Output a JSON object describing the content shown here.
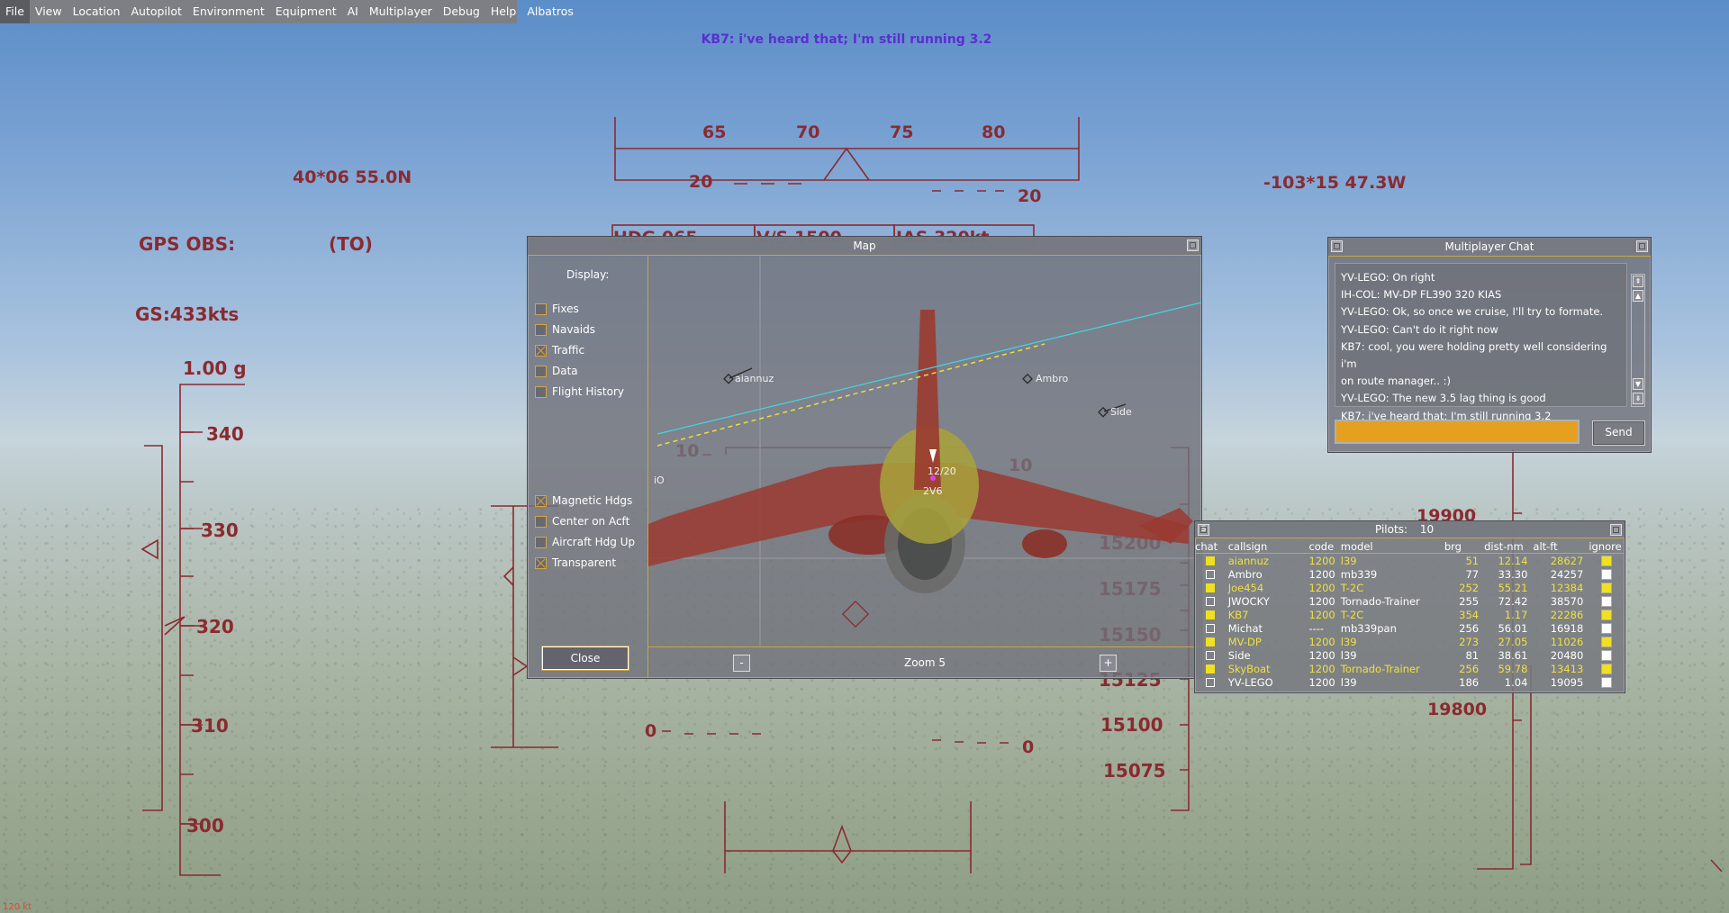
{
  "menu": [
    "File",
    "View",
    "Location",
    "Autopilot",
    "Environment",
    "Equipment",
    "AI",
    "Multiplayer",
    "Debug",
    "Help",
    "Albatros"
  ],
  "broadcast": "KB7: i've heard that; I'm still running 3.2",
  "hud": {
    "lat": "40*06 55.0N",
    "lon": "-103*15 47.3W",
    "gps_obs": "GPS OBS:",
    "to_from": "(TO)",
    "gs": "GS:433kts",
    "g_load": "1.00 g",
    "heading_ticks": [
      "65",
      "70",
      "75",
      "80"
    ],
    "pitch_top_left": "20",
    "pitch_top_right": "20",
    "pitch_mid_left": "10",
    "pitch_mid_right": "10",
    "pitch_zero_left": "0",
    "pitch_zero_right": "0",
    "hdg_box": "HDG 065",
    "vs_box": "V/S 1500",
    "ias_box": "IAS 320kt",
    "speed_ticks": [
      "340",
      "330",
      "320",
      "310",
      "300"
    ],
    "alt_ticks": [
      "15200",
      "15175",
      "15150",
      "15125",
      "15100",
      "15075"
    ],
    "alt_right_ticks": [
      "19900",
      "19800"
    ],
    "corner_text": "120 kt"
  },
  "map": {
    "title": "Map",
    "display_label": "Display:",
    "options": [
      {
        "label": "Fixes",
        "checked": false
      },
      {
        "label": "Navaids",
        "checked": false
      },
      {
        "label": "Traffic",
        "checked": true
      },
      {
        "label": "Data",
        "checked": false
      },
      {
        "label": "Flight History",
        "checked": false
      }
    ],
    "options2": [
      {
        "label": "Magnetic Hdgs",
        "checked": true
      },
      {
        "label": "Center on Acft",
        "checked": false
      },
      {
        "label": "Aircraft Hdg Up",
        "checked": false
      },
      {
        "label": "Transparent",
        "checked": true
      }
    ],
    "close_label": "Close",
    "zoom_label": "Zoom 5",
    "zoom_minus": "-",
    "zoom_plus": "+",
    "traffic": [
      "aiannuz",
      "Ambro",
      "Side"
    ],
    "own_label_top": "12/20",
    "own_label_bottom": "2V6",
    "edge_label": "iO"
  },
  "chat": {
    "title": "Multiplayer Chat",
    "messages": [
      "YV-LEGO: On right",
      "IH-COL: MV-DP FL390 320 KIAS",
      "YV-LEGO: Ok, so once we cruise, I'll try to formate.",
      "YV-LEGO: Can't do it right now",
      "KB7: cool, you were holding pretty well considering i'm",
      "on route manager.. :)",
      "YV-LEGO: The new 3.5 lag thing is good",
      "KB7: i've heard that; I'm still running 3.2"
    ],
    "input_value": "",
    "send_label": "Send"
  },
  "pilots": {
    "title": "Pilots:",
    "count": "10",
    "corner_btn": "S",
    "columns": [
      "chat",
      "callsign",
      "code",
      "model",
      "brg",
      "dist-nm",
      "alt-ft",
      "ignore"
    ],
    "rows": [
      {
        "callsign": "aiannuz",
        "code": "1200",
        "model": "l39",
        "brg": "51",
        "dist": "12.14",
        "alt": "28627",
        "sel": true,
        "ignore": true
      },
      {
        "callsign": "Ambro",
        "code": "1200",
        "model": "mb339",
        "brg": "77",
        "dist": "33.30",
        "alt": "24257",
        "sel": false,
        "ignore": false
      },
      {
        "callsign": "Joe454",
        "code": "1200",
        "model": "T-2C",
        "brg": "252",
        "dist": "55.21",
        "alt": "12384",
        "sel": true,
        "ignore": true
      },
      {
        "callsign": "JWOCKY",
        "code": "1200",
        "model": "Tornado-Trainer",
        "brg": "255",
        "dist": "72.42",
        "alt": "38570",
        "sel": false,
        "ignore": false
      },
      {
        "callsign": "KB7",
        "code": "1200",
        "model": "T-2C",
        "brg": "354",
        "dist": "1.17",
        "alt": "22286",
        "sel": true,
        "ignore": true
      },
      {
        "callsign": "Michat",
        "code": "----",
        "model": "mb339pan",
        "brg": "256",
        "dist": "56.01",
        "alt": "16918",
        "sel": false,
        "ignore": false
      },
      {
        "callsign": "MV-DP",
        "code": "1200",
        "model": "l39",
        "brg": "273",
        "dist": "27.05",
        "alt": "11026",
        "sel": true,
        "ignore": true
      },
      {
        "callsign": "Side",
        "code": "1200",
        "model": "l39",
        "brg": "81",
        "dist": "38.61",
        "alt": "20480",
        "sel": false,
        "ignore": false
      },
      {
        "callsign": "SkyBoat",
        "code": "1200",
        "model": "Tornado-Trainer",
        "brg": "256",
        "dist": "59.78",
        "alt": "13413",
        "sel": true,
        "ignore": true
      },
      {
        "callsign": "YV-LEGO",
        "code": "1200",
        "model": "l39",
        "brg": "186",
        "dist": "1.04",
        "alt": "19095",
        "sel": false,
        "ignore": false
      }
    ]
  }
}
